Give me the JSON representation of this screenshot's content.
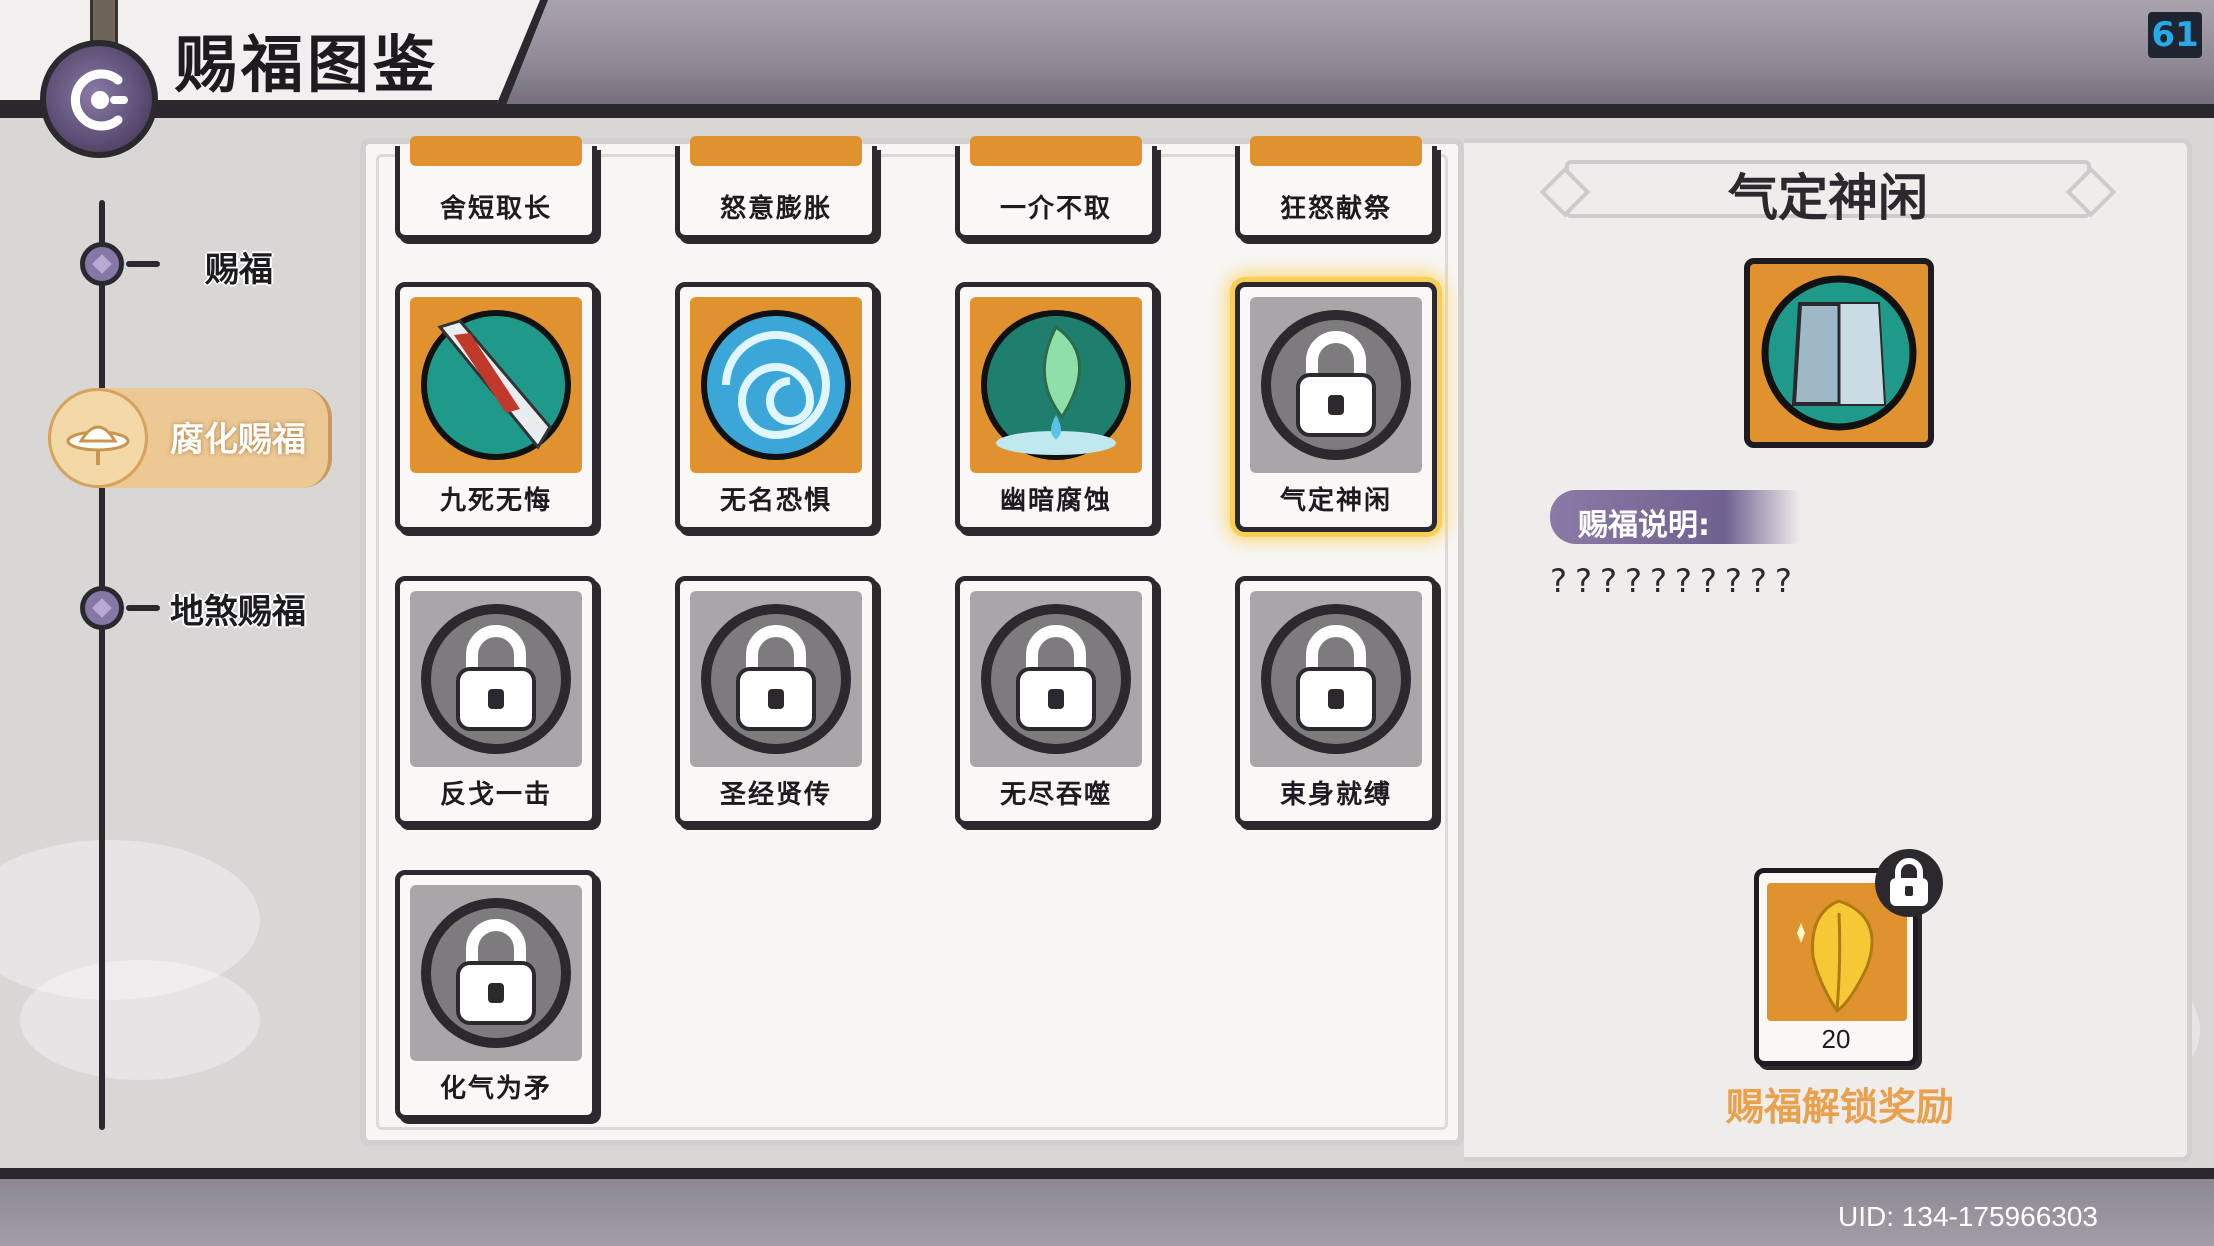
{
  "header": {
    "title": "赐福图鉴",
    "back_icon": "back-arrow-icon",
    "fps": "61"
  },
  "nav": {
    "items": [
      {
        "label": "赐福",
        "active": false
      },
      {
        "label": "腐化赐福",
        "active": true
      },
      {
        "label": "地煞赐福",
        "active": false
      }
    ]
  },
  "cards": {
    "row0": [
      "舍短取长",
      "怒意膨胀",
      "一介不取",
      "狂怒献祭"
    ],
    "row1": [
      {
        "label": "九死无悔",
        "locked": false,
        "icon": "sword-icon"
      },
      {
        "label": "无名恐惧",
        "locked": false,
        "icon": "vortex-icon"
      },
      {
        "label": "幽暗腐蚀",
        "locked": false,
        "icon": "leaf-drop-icon"
      },
      {
        "label": "气定神闲",
        "locked": true,
        "selected": true,
        "icon": "lock-icon"
      }
    ],
    "row2": [
      {
        "label": "反戈一击",
        "locked": true,
        "icon": "lock-icon"
      },
      {
        "label": "圣经贤传",
        "locked": true,
        "icon": "lock-icon"
      },
      {
        "label": "无尽吞噬",
        "locked": true,
        "icon": "lock-icon"
      },
      {
        "label": "束身就缚",
        "locked": true,
        "icon": "lock-icon"
      }
    ],
    "row3": [
      {
        "label": "化气为矛",
        "locked": true,
        "icon": "lock-icon"
      }
    ]
  },
  "detail": {
    "title": "气定神闲",
    "icon": "scroll-shield-icon",
    "desc_heading": "赐福说明:",
    "desc_text": "??????????",
    "reward": {
      "count": "20",
      "icon": "golden-leaf-icon",
      "locked": true,
      "label": "赐福解锁奖励"
    }
  },
  "footer": {
    "uid": "UID:  134-175966303"
  },
  "colors": {
    "accent_orange": "#e0922f",
    "nav_active": "#ebc894",
    "purple": "#8a7aa6",
    "selected_glow": "#f6cf57",
    "reward_label": "#e8a24d",
    "fps": "#27a9e8"
  }
}
